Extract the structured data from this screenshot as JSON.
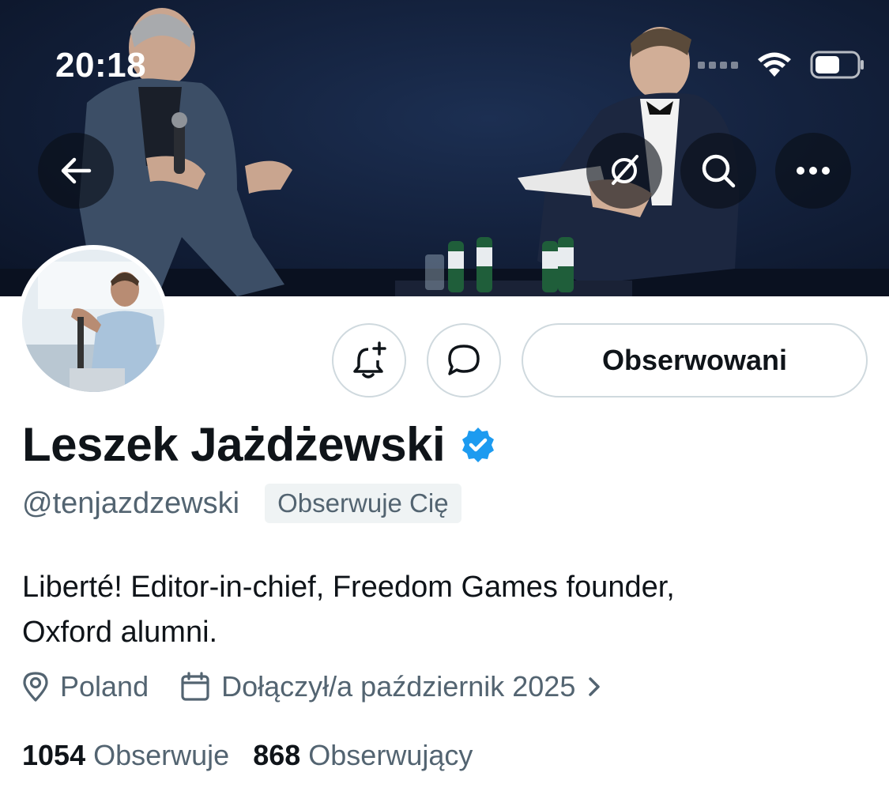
{
  "status_bar": {
    "time": "20:18"
  },
  "icons": {
    "back": "arrow-left-icon",
    "grok": "grok-icon",
    "search": "search-icon",
    "more": "more-dots-icon",
    "notify": "bell-plus-icon",
    "message": "chat-bubble-icon",
    "verified": "verified-badge-icon",
    "location": "location-pin-icon",
    "calendar": "calendar-icon",
    "chevron": "chevron-right-icon"
  },
  "profile": {
    "follow_button_label": "Obserwowani",
    "display_name": "Leszek Jażdżewski",
    "handle": "@tenjazdzewski",
    "follows_you_badge": "Obserwuje Cię",
    "bio_line1": "Liberté! Editor-in-chief, Freedom Games founder,",
    "bio_line2": "Oxford alumni.",
    "location": "Poland",
    "joined": "Dołączył/a październik 2025",
    "following_count": "1054",
    "following_label": "Obserwuje",
    "followers_count": "868",
    "followers_label": "Obserwujący"
  },
  "colors": {
    "verified_blue": "#1d9bf0",
    "secondary_text": "#536471",
    "border": "#cfd9de"
  }
}
